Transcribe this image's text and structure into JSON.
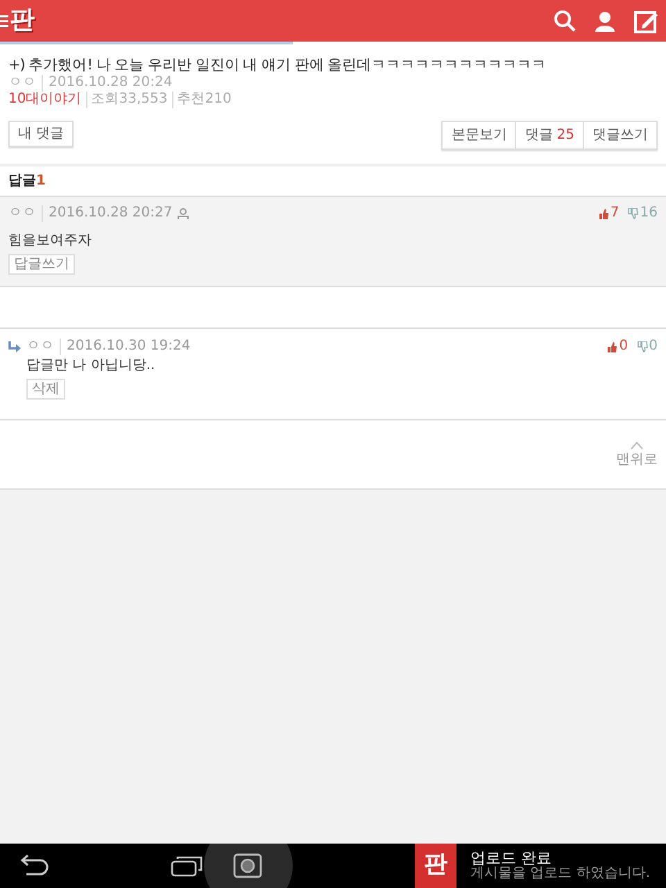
{
  "header": {
    "logo": "판",
    "loading": {
      "level": 0.44
    }
  },
  "post": {
    "title": "+) 추가했어! 나 오늘 우리반 일진이 내 얘기 판에 올린데ㅋㅋㅋㅋㅋㅋㅋㅋㅋㅋㅋㅋ",
    "author": "ㅇㅇ",
    "date": "2016.10.28 20:24",
    "category": "10대이야기",
    "views": "조회33,553",
    "recommend": "추천210"
  },
  "toolbar": {
    "my_comments": "내 댓글",
    "buttons": [
      {
        "label": "본문보기"
      },
      {
        "label": "댓글",
        "count": "25"
      },
      {
        "label": "댓글쓰기"
      }
    ]
  },
  "replies_header": {
    "label": "답글",
    "count": "1"
  },
  "comments": [
    {
      "kind": "comment",
      "author": "ㅇㅇ",
      "date": "2016.10.28 20:27",
      "text": "힘을보여주자",
      "likes": "7",
      "dislikes": "16",
      "action": "답글쓰기"
    },
    {
      "kind": "reply",
      "author": "ㅇㅇ",
      "date": "2016.10.30 19:24",
      "text": "답글만 나 아닙니당..",
      "likes": "0",
      "dislikes": "0",
      "action": "삭제"
    }
  ],
  "to_top": "맨위로",
  "notification": {
    "icon_text": "판",
    "title": "업로드 완료",
    "message": "게시물을 업로드 하였습니다."
  }
}
